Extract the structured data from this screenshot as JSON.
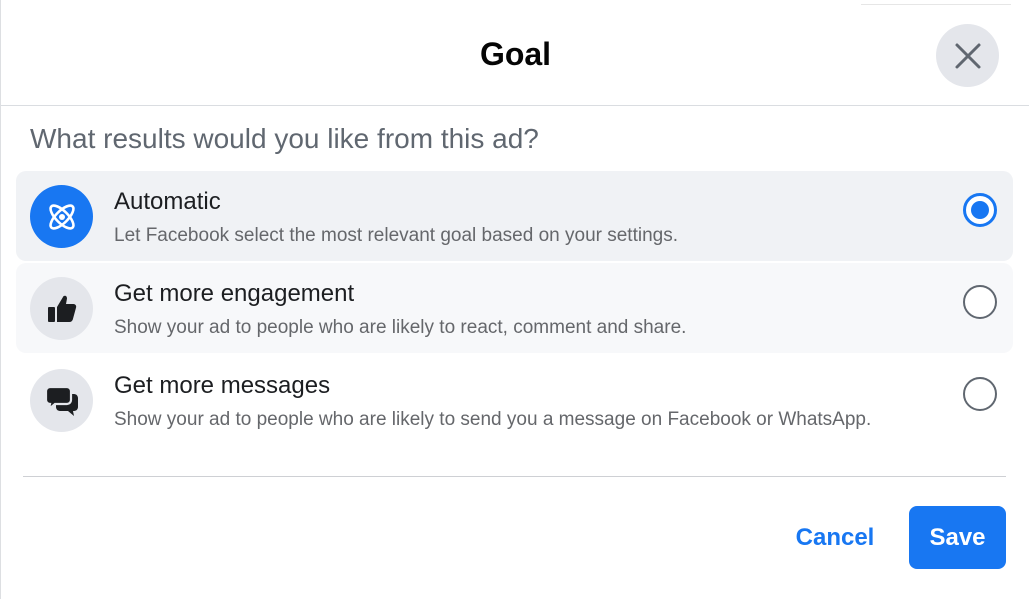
{
  "dialog": {
    "title": "Goal",
    "close_icon": "close-icon",
    "question": "What results would you like from this ad?"
  },
  "options": [
    {
      "title": "Automatic",
      "description": "Let Facebook select the most relevant goal based on your settings.",
      "icon": "atom-icon",
      "selected": true
    },
    {
      "title": "Get more engagement",
      "description": "Show your ad to people who are likely to react, comment and share.",
      "icon": "thumbs-up-icon",
      "selected": false
    },
    {
      "title": "Get more messages",
      "description": "Show your ad to people who are likely to send you a message on Facebook or WhatsApp.",
      "icon": "chat-bubbles-icon",
      "selected": false
    }
  ],
  "footer": {
    "cancel_label": "Cancel",
    "save_label": "Save"
  },
  "colors": {
    "accent": "#1877f2",
    "selected_bg": "#f0f2f5",
    "text_primary": "#1c1e21",
    "text_secondary": "#65676b"
  }
}
